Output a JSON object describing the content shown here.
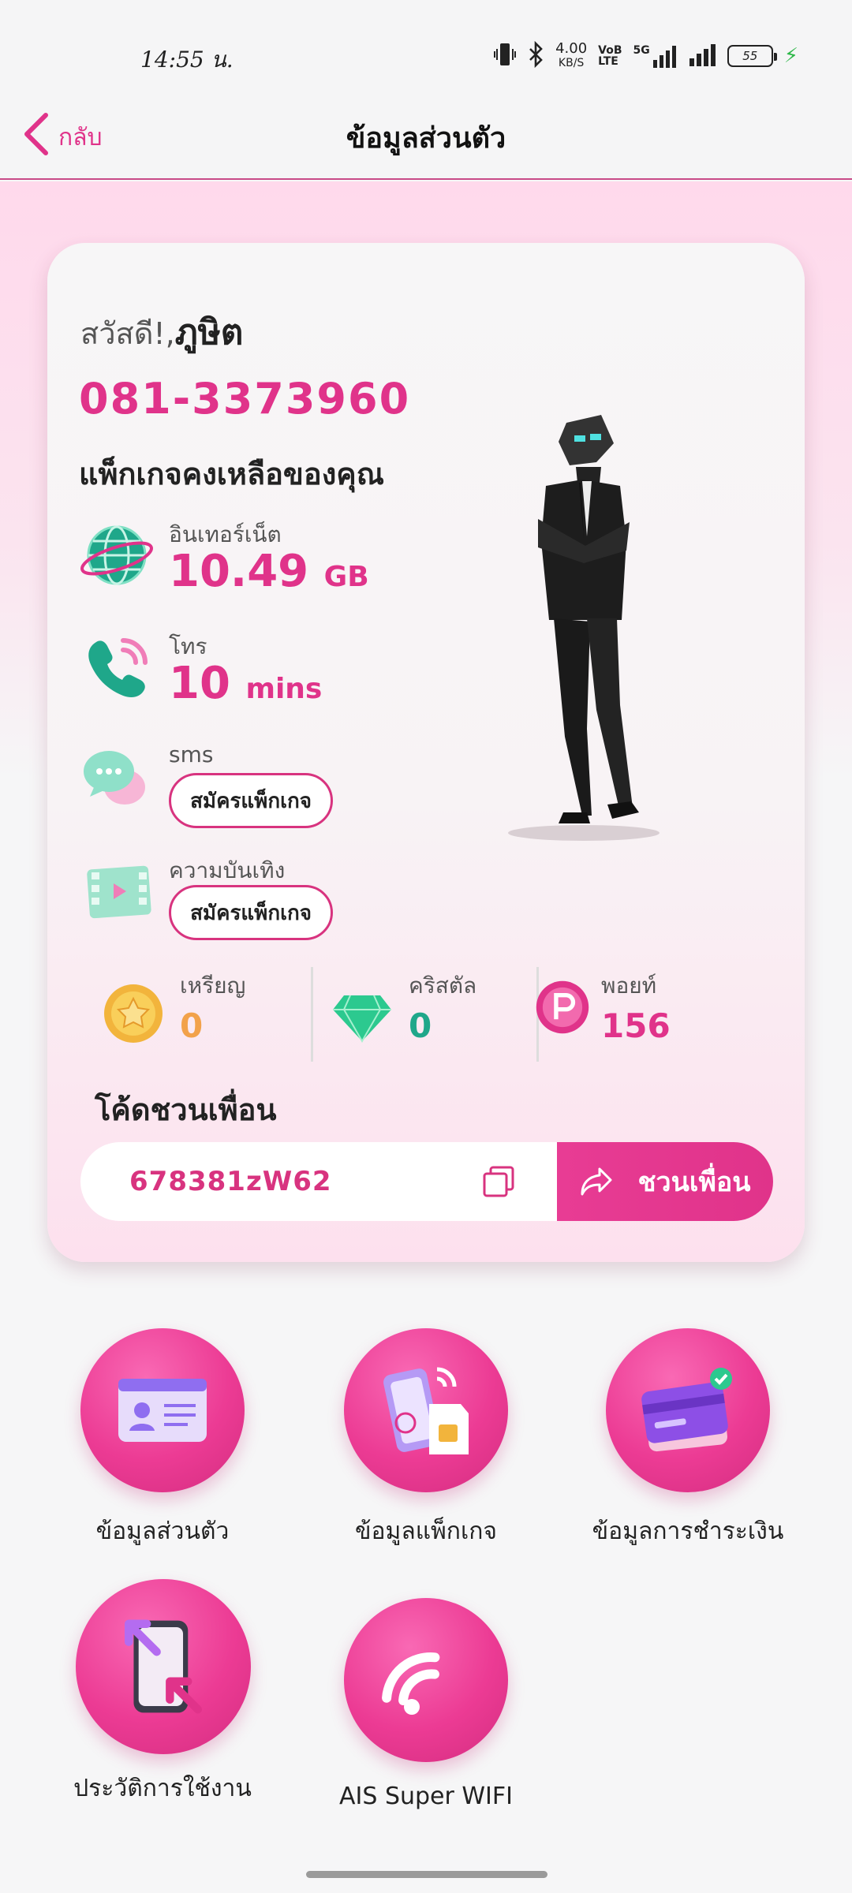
{
  "status_bar": {
    "time": "14:55 น.",
    "net_speed": "4.00",
    "net_unit": "KB/S",
    "volte_top": "VoB",
    "volte_bottom": "LTE",
    "network": "5G",
    "battery": "55"
  },
  "header": {
    "back_label": "กลับ",
    "title": "ข้อมูลส่วนตัว"
  },
  "profile": {
    "greeting_prefix": "สวัสดี!,",
    "name": "ภูษิต",
    "phone": "081-3373960",
    "packages_heading": "แพ็กเกจคงเหลือของคุณ"
  },
  "packages": {
    "internet": {
      "label": "อินเทอร์เน็ต",
      "value": "10.49",
      "unit": "GB"
    },
    "call": {
      "label": "โทร",
      "value": "10",
      "unit": "mins"
    },
    "sms": {
      "label": "sms",
      "button": "สมัครแพ็กเกจ"
    },
    "entertainment": {
      "label": "ความบันเทิง",
      "button": "สมัครแพ็กเกจ"
    }
  },
  "rewards": {
    "coin": {
      "label": "เหรียญ",
      "value": "0",
      "color": "#f2a24a"
    },
    "crystal": {
      "label": "คริสตัล",
      "value": "0",
      "color": "#1fa78a"
    },
    "point": {
      "label": "พอยท์",
      "value": "156",
      "color": "#e0338a"
    }
  },
  "referral": {
    "title": "โค้ดชวนเพื่อน",
    "code": "678381zW62",
    "invite_label": "ชวนเพื่อน"
  },
  "menu": {
    "personal_info": "ข้อมูลส่วนตัว",
    "package_info": "ข้อมูลแพ็กเกจ",
    "payment_info": "ข้อมูลการชำระเงิน",
    "usage_history": "ประวัติการใช้งาน",
    "super_wifi": "AIS Super WIFI"
  },
  "colors": {
    "accent": "#e0338a",
    "header_border": "#c84b88"
  }
}
